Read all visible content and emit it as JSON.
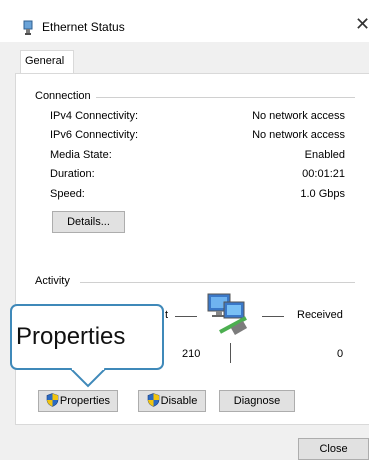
{
  "window": {
    "title": "Ethernet Status",
    "title_icon": "network-adapter-icon",
    "close_glyph": "✕"
  },
  "tabs": [
    {
      "label": "General",
      "selected": true
    }
  ],
  "connection": {
    "group_label": "Connection",
    "rows": [
      {
        "label": "IPv4 Connectivity:",
        "value": "No network access"
      },
      {
        "label": "IPv6 Connectivity:",
        "value": "No network access"
      },
      {
        "label": "Media State:",
        "value": "Enabled"
      },
      {
        "label": "Duration:",
        "value": "00:01:21"
      },
      {
        "label": "Speed:",
        "value": "1.0 Gbps"
      }
    ],
    "details_button": "Details..."
  },
  "activity": {
    "group_label": "Activity",
    "sent_fragment": "t",
    "received_label": "Received",
    "sent_value_fragment": "210",
    "received_value": "0",
    "icon": "network-computers-icon"
  },
  "buttons": {
    "properties": "Properties",
    "disable": "Disable",
    "diagnose": "Diagnose",
    "close": "Close",
    "shield_icon": "uac-shield-icon"
  },
  "callout": {
    "text": "Properties",
    "border_color": "#3f89b9"
  }
}
